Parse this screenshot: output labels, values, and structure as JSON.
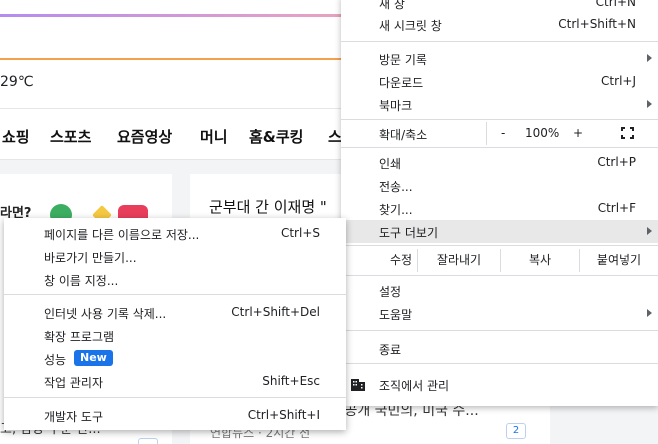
{
  "background": {
    "temperature": "29℃",
    "nav_items": [
      "쇼핑",
      "스포츠",
      "요즘영상",
      "머니",
      "홈&쿠킹",
      "스"
    ],
    "left_question_partial": "라면?",
    "headline_partial": "군부대 간 이재명 \"",
    "bottom_snippet": "·공개 국민의, 미국 수...",
    "source_text": "연합뉴스 · 2시간 전",
    "left_snippet": "고, 담당 수훈 한...",
    "comment_count": "2",
    "colors": {
      "accent": "#1a73e8",
      "orange": "#f5a04a"
    }
  },
  "main_menu": {
    "new_window": {
      "label": "새 창",
      "shortcut": "Ctrl+N"
    },
    "new_incognito": {
      "label": "새 시크릿 창",
      "shortcut": "Ctrl+Shift+N"
    },
    "history": {
      "label": "방문 기록"
    },
    "downloads": {
      "label": "다운로드",
      "shortcut": "Ctrl+J"
    },
    "bookmarks": {
      "label": "북마크"
    },
    "zoom": {
      "label": "확대/축소",
      "minus": "-",
      "value": "100%",
      "plus": "+"
    },
    "print": {
      "label": "인쇄",
      "shortcut": "Ctrl+P"
    },
    "cast": {
      "label": "전송..."
    },
    "find": {
      "label": "찾기...",
      "shortcut": "Ctrl+F"
    },
    "more_tools": {
      "label": "도구 더보기"
    },
    "edit": {
      "label": "수정",
      "cut": "잘라내기",
      "copy": "복사",
      "paste": "붙여넣기"
    },
    "settings": {
      "label": "설정"
    },
    "help": {
      "label": "도움말"
    },
    "exit": {
      "label": "종료"
    },
    "managed": {
      "label": "조직에서 관리"
    }
  },
  "sub_menu": {
    "save_page": {
      "label": "페이지를 다른 이름으로 저장...",
      "shortcut": "Ctrl+S"
    },
    "create_shortcut": {
      "label": "바로가기 만들기..."
    },
    "name_window": {
      "label": "창 이름 지정..."
    },
    "clear_data": {
      "label": "인터넷 사용 기록 삭제...",
      "shortcut": "Ctrl+Shift+Del"
    },
    "extensions": {
      "label": "확장 프로그램"
    },
    "performance": {
      "label": "성능",
      "badge": "New"
    },
    "task_manager": {
      "label": "작업 관리자",
      "shortcut": "Shift+Esc"
    },
    "dev_tools": {
      "label": "개발자 도구",
      "shortcut": "Ctrl+Shift+I"
    }
  }
}
